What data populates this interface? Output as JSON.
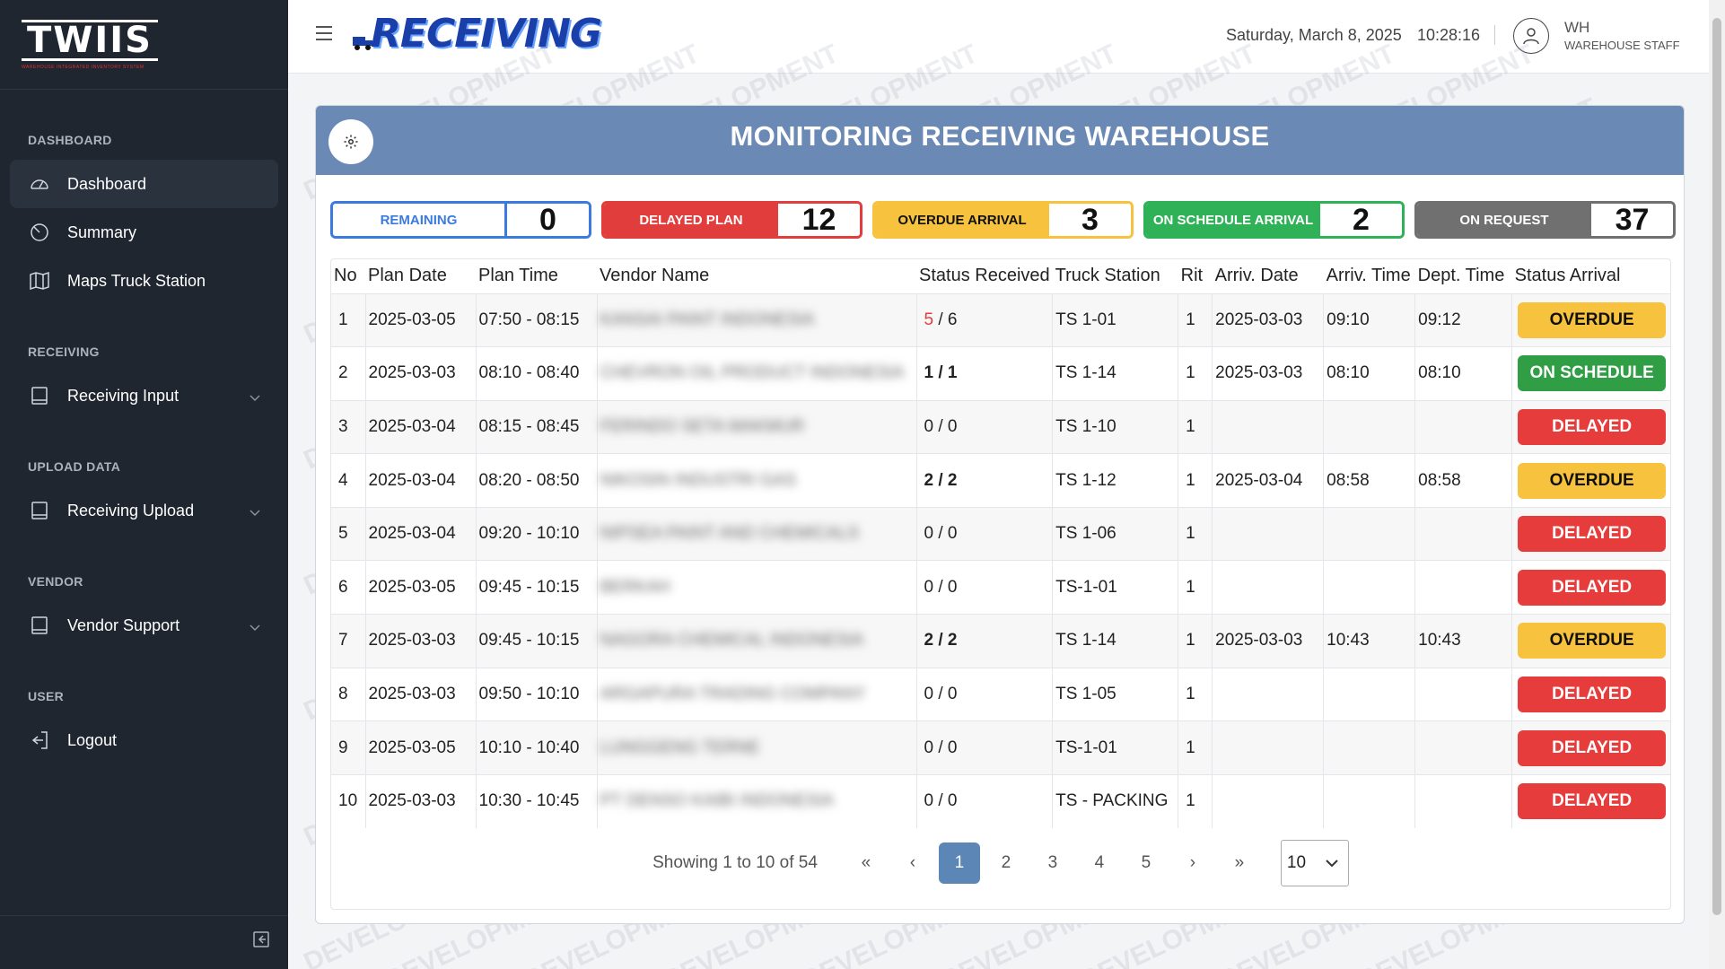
{
  "sidebar": {
    "logo": "TWIIS",
    "logo_sub": "WAREHOUSE INTEGRATED INVENTORY SYSTEM",
    "sections": [
      {
        "title": "DASHBOARD",
        "items": [
          {
            "label": "Dashboard",
            "icon": "dashboard-gauge-icon",
            "active": true
          },
          {
            "label": "Summary",
            "icon": "pie-chart-icon"
          },
          {
            "label": "Maps Truck Station",
            "icon": "map-icon"
          }
        ]
      },
      {
        "title": "RECEIVING",
        "items": [
          {
            "label": "Receiving Input",
            "icon": "document-icon",
            "expandable": true
          }
        ]
      },
      {
        "title": "UPLOAD DATA",
        "items": [
          {
            "label": "Receiving Upload",
            "icon": "document-icon",
            "expandable": true
          }
        ]
      },
      {
        "title": "VENDOR",
        "items": [
          {
            "label": "Vendor Support",
            "icon": "document-icon",
            "expandable": true
          }
        ]
      },
      {
        "title": "USER",
        "items": [
          {
            "label": "Logout",
            "icon": "logout-icon"
          }
        ]
      }
    ]
  },
  "header": {
    "title": "RECEIVING",
    "date": "Saturday, March 8, 2025",
    "time": "10:28:16",
    "user_name": "WH",
    "user_role": "WAREHOUSE STAFF"
  },
  "card": {
    "title": "MONITORING RECEIVING WAREHOUSE",
    "stats": [
      {
        "label": "REMAINING",
        "value": "0",
        "color": "#3b7be0"
      },
      {
        "label": "DELAYED PLAN",
        "value": "12",
        "color": "#e13d3d"
      },
      {
        "label": "OVERDUE ARRIVAL",
        "value": "3",
        "color": "#f7c23d"
      },
      {
        "label": "ON SCHEDULE ARRIVAL",
        "value": "2",
        "color": "#2fb157"
      },
      {
        "label": "ON REQUEST",
        "value": "37",
        "color": "#707070"
      }
    ]
  },
  "table": {
    "columns": [
      "No",
      "Plan Date",
      "Plan Time",
      "Vendor Name",
      "Status Received",
      "Truck Station",
      "Rit",
      "Arriv. Date",
      "Arriv. Time",
      "Dept. Time",
      "Status Arrival"
    ],
    "rows": [
      {
        "no": "1",
        "plan_date": "2025-03-05",
        "plan_time": "07:50 - 08:15",
        "vendor": "KANSAI PAINT INDONESIA",
        "recv_a": "5",
        "recv_b": " / 6",
        "recv_a_red": true,
        "recv_bold": false,
        "station": "TS 1-01",
        "rit": "1",
        "arr_date": "2025-03-03",
        "arr_time": "09:10",
        "dept_time": "09:12",
        "status": "OVERDUE"
      },
      {
        "no": "2",
        "plan_date": "2025-03-03",
        "plan_time": "08:10 - 08:40",
        "vendor": "CHEVRON OIL PRODUCT INDONESIA",
        "recv_a": "1",
        "recv_b": " / 1",
        "recv_a_red": false,
        "recv_bold": true,
        "station": "TS 1-14",
        "rit": "1",
        "arr_date": "2025-03-03",
        "arr_time": "08:10",
        "dept_time": "08:10",
        "status": "ON SCHEDULE"
      },
      {
        "no": "3",
        "plan_date": "2025-03-04",
        "plan_time": "08:15 - 08:45",
        "vendor": "FERINDO SETA MAKMUR",
        "recv_a": "0",
        "recv_b": " / 0",
        "recv_a_red": false,
        "recv_bold": false,
        "station": "TS 1-10",
        "rit": "1",
        "arr_date": "",
        "arr_time": "",
        "dept_time": "",
        "status": "DELAYED"
      },
      {
        "no": "4",
        "plan_date": "2025-03-04",
        "plan_time": "08:20 - 08:50",
        "vendor": "NIKOSIN INDUSTRI GAS",
        "recv_a": "2",
        "recv_b": " / 2",
        "recv_a_red": false,
        "recv_bold": true,
        "station": "TS 1-12",
        "rit": "1",
        "arr_date": "2025-03-04",
        "arr_time": "08:58",
        "dept_time": "08:58",
        "status": "OVERDUE"
      },
      {
        "no": "5",
        "plan_date": "2025-03-04",
        "plan_time": "09:20 - 10:10",
        "vendor": "NIPSEA PAINT AND CHEMICALS",
        "recv_a": "0",
        "recv_b": " / 0",
        "recv_a_red": false,
        "recv_bold": false,
        "station": "TS 1-06",
        "rit": "1",
        "arr_date": "",
        "arr_time": "",
        "dept_time": "",
        "status": "DELAYED"
      },
      {
        "no": "6",
        "plan_date": "2025-03-05",
        "plan_time": "09:45 - 10:15",
        "vendor": "BERKAH",
        "recv_a": "0",
        "recv_b": " / 0",
        "recv_a_red": false,
        "recv_bold": false,
        "station": "TS-1-01",
        "rit": "1",
        "arr_date": "",
        "arr_time": "",
        "dept_time": "",
        "status": "DELAYED"
      },
      {
        "no": "7",
        "plan_date": "2025-03-03",
        "plan_time": "09:45 - 10:15",
        "vendor": "NAGORA CHEMICAL INDONESIA",
        "recv_a": "2",
        "recv_b": " / 2",
        "recv_a_red": false,
        "recv_bold": true,
        "station": "TS 1-14",
        "rit": "1",
        "arr_date": "2025-03-03",
        "arr_time": "10:43",
        "dept_time": "10:43",
        "status": "OVERDUE"
      },
      {
        "no": "8",
        "plan_date": "2025-03-03",
        "plan_time": "09:50 - 10:10",
        "vendor": "ARGAPURA TRADING COMPANY",
        "recv_a": "0",
        "recv_b": " / 0",
        "recv_a_red": false,
        "recv_bold": false,
        "station": "TS 1-05",
        "rit": "1",
        "arr_date": "",
        "arr_time": "",
        "dept_time": "",
        "status": "DELAYED"
      },
      {
        "no": "9",
        "plan_date": "2025-03-05",
        "plan_time": "10:10 - 10:40",
        "vendor": "LUNGGENG TERNE",
        "recv_a": "0",
        "recv_b": " / 0",
        "recv_a_red": false,
        "recv_bold": false,
        "station": "TS-1-01",
        "rit": "1",
        "arr_date": "",
        "arr_time": "",
        "dept_time": "",
        "status": "DELAYED"
      },
      {
        "no": "10",
        "plan_date": "2025-03-03",
        "plan_time": "10:30 - 10:45",
        "vendor": "PT DENSO KAIBI INDONESIA",
        "recv_a": "0",
        "recv_b": " / 0",
        "recv_a_red": false,
        "recv_bold": false,
        "station": "TS - PACKING",
        "rit": "1",
        "arr_date": "",
        "arr_time": "",
        "dept_time": "",
        "status": "DELAYED"
      }
    ]
  },
  "pagination": {
    "showing": "Showing 1 to 10 of 54",
    "first": "«",
    "prev": "‹",
    "pages": [
      "1",
      "2",
      "3",
      "4",
      "5"
    ],
    "current": "1",
    "next": "›",
    "last": "»",
    "page_size": "10"
  },
  "watermark": "DEVELOPMENT"
}
